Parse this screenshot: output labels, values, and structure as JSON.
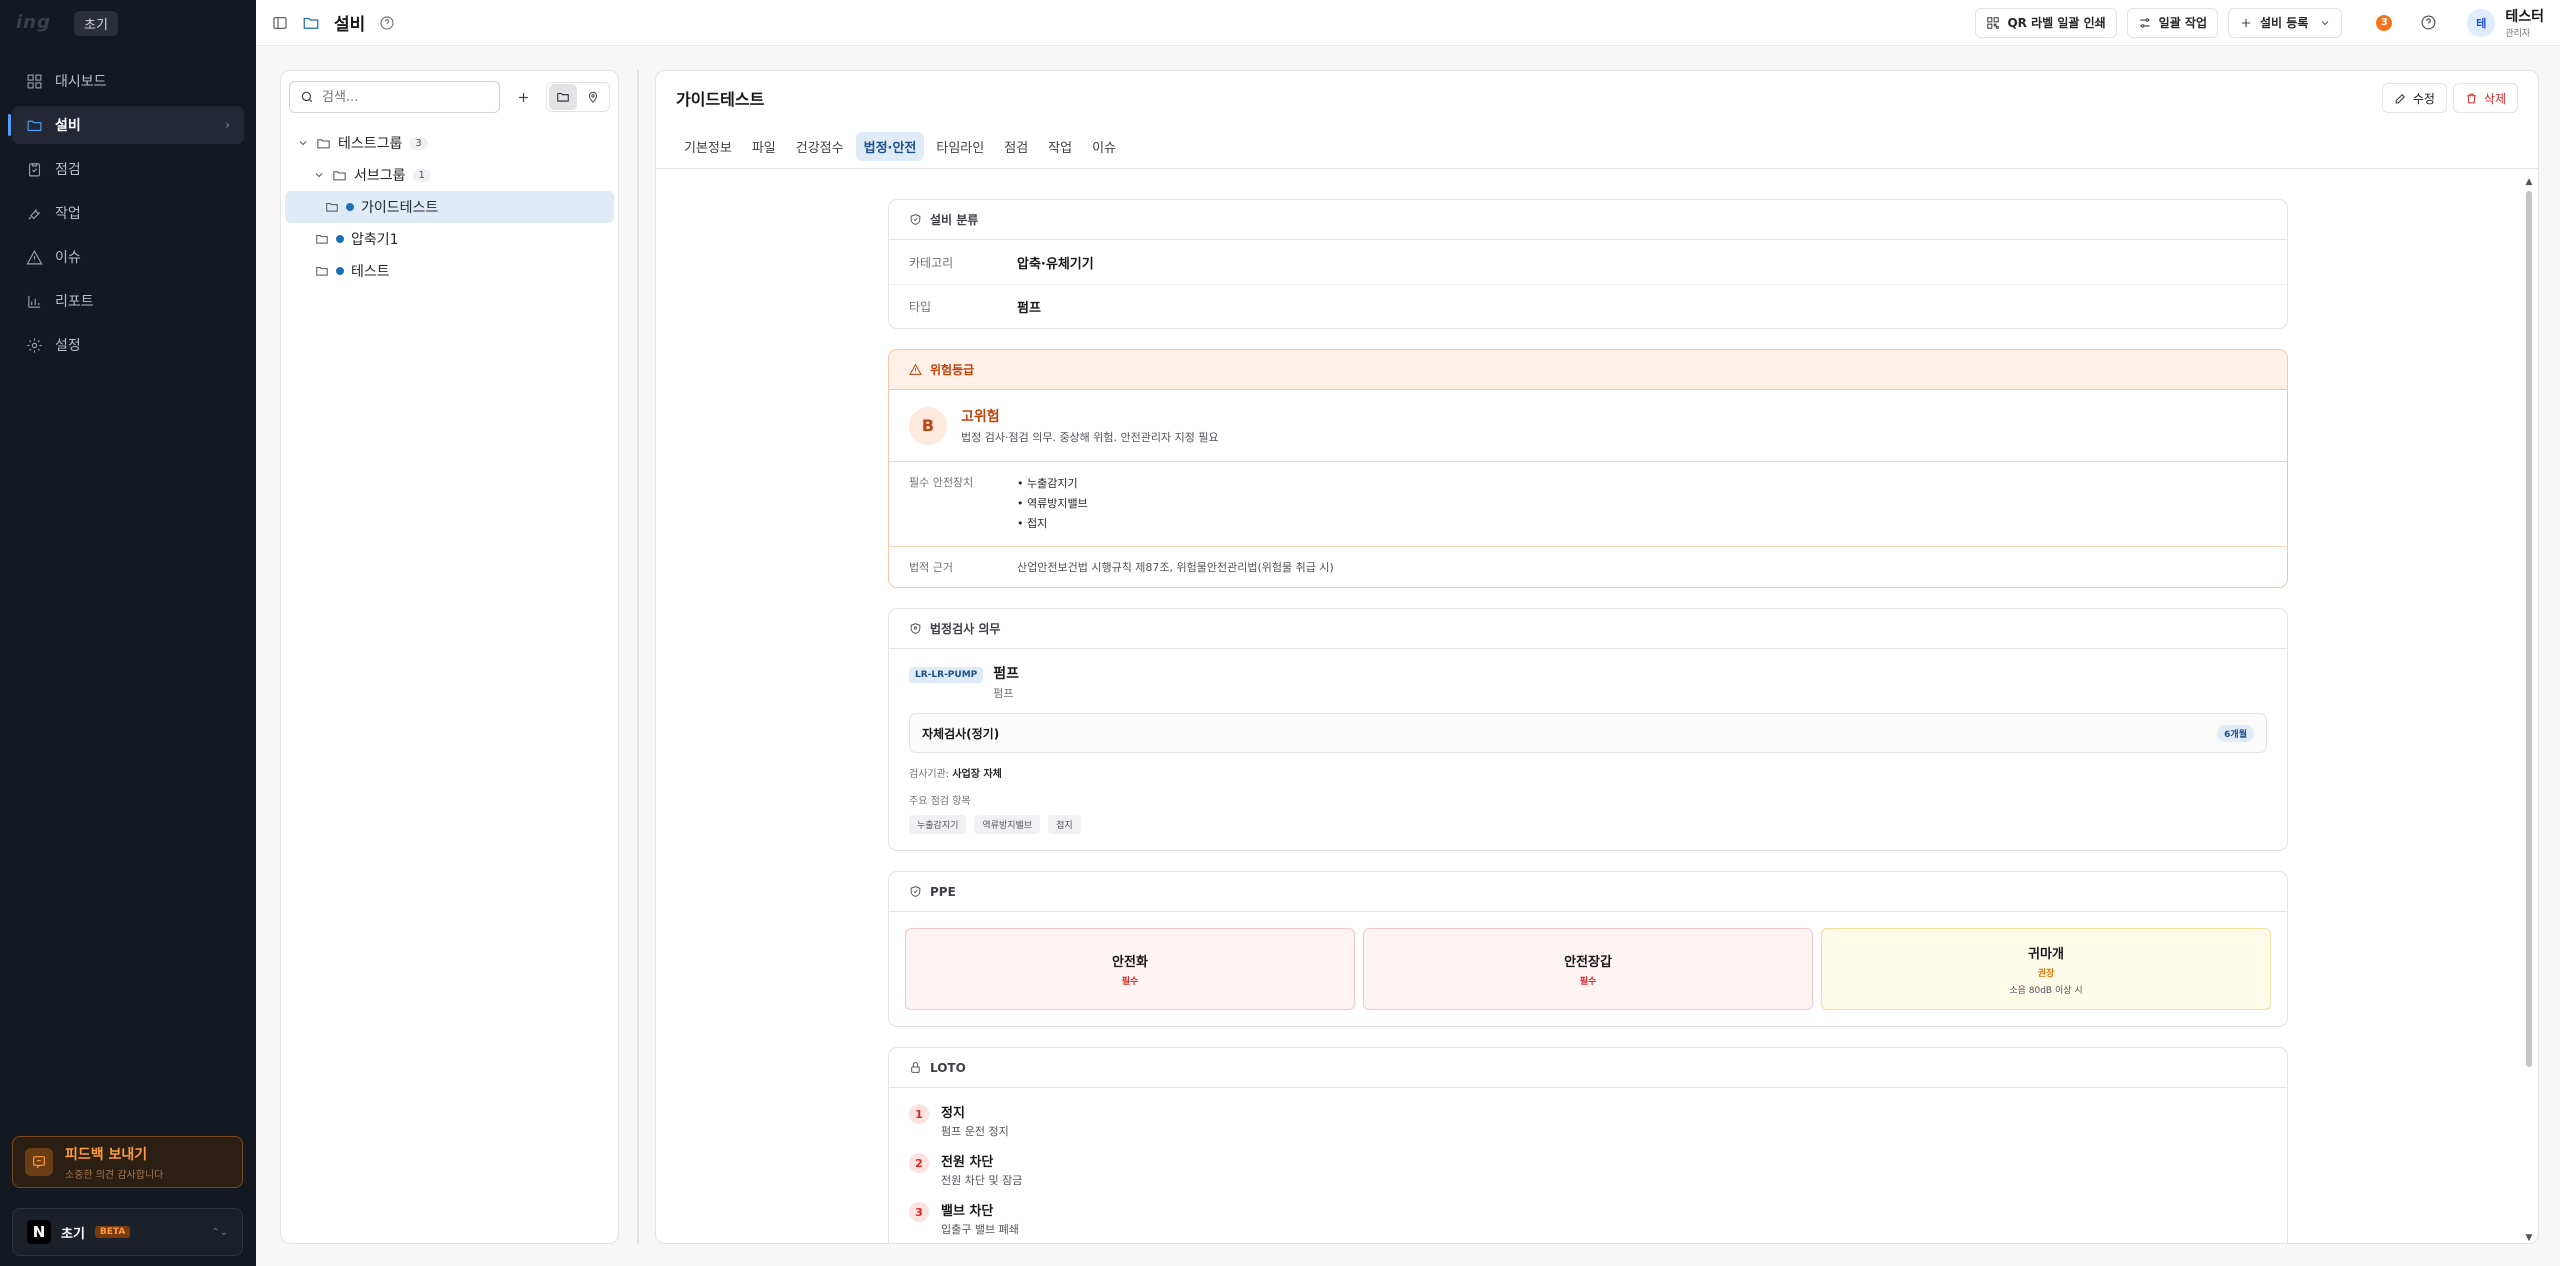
{
  "sidebar": {
    "logo": "ing",
    "org_badge": "초기",
    "items": [
      {
        "label": "대시보드",
        "icon": "grid-icon"
      },
      {
        "label": "설비",
        "icon": "folder-icon"
      },
      {
        "label": "점검",
        "icon": "clipboard-icon"
      },
      {
        "label": "작업",
        "icon": "wrench-icon"
      },
      {
        "label": "이슈",
        "icon": "alert-triangle-icon"
      },
      {
        "label": "리포트",
        "icon": "bar-chart-icon"
      },
      {
        "label": "설정",
        "icon": "gear-icon"
      }
    ],
    "feedback": {
      "title": "피드백 보내기",
      "subtitle": "소중한 의견 감사합니다"
    },
    "workspace": {
      "logo": "N",
      "name": "초기",
      "badge": "BETA"
    }
  },
  "header": {
    "title": "설비",
    "qr_label": "QR 라벨 일괄 인쇄",
    "bulk_label": "일괄 작업",
    "register_label": "설비 등록",
    "notif_count": "3",
    "user": {
      "initial": "테",
      "name": "테스터",
      "role": "관리자"
    }
  },
  "tree": {
    "search_placeholder": "검색...",
    "nodes": [
      {
        "label": "테스트그룹",
        "count": "3"
      },
      {
        "label": "서브그룹",
        "count": "1"
      },
      {
        "label": "가이드테스트"
      },
      {
        "label": "압축기1"
      },
      {
        "label": "테스트"
      }
    ]
  },
  "detail": {
    "title": "가이드테스트",
    "edit_label": "수정",
    "delete_label": "삭제",
    "tabs": [
      "기본정보",
      "파일",
      "건강점수",
      "법정·안전",
      "타임라인",
      "점검",
      "작업",
      "이슈"
    ],
    "classification": {
      "header": "설비 분류",
      "rows": [
        {
          "k": "카테고리",
          "v": "압축·유체기기"
        },
        {
          "k": "타입",
          "v": "펌프"
        }
      ]
    },
    "risk": {
      "header": "위험등급",
      "grade": "B",
      "title": "고위험",
      "desc": "법정 검사·점검 의무. 중상해 위험. 안전관리자 지정 필요",
      "devices_label": "필수 안전장치",
      "devices": [
        "누출감지기",
        "역류방지밸브",
        "접지"
      ],
      "basis_label": "법적 근거",
      "basis": "산업안전보건법 시행규칙 제87조, 위험물안전관리법(위험물 취급 시)"
    },
    "inspection": {
      "header": "법정검사 의무",
      "code": "LR-LR-PUMP",
      "name": "펌프",
      "sub": "펌프",
      "bar_title": "자체검사(정기)",
      "cycle": "6개월",
      "authority_label": "검사기관:",
      "authority": "사업장 자체",
      "items_label": "주요 점검 항목",
      "items": [
        "누출감지기",
        "역류방지밸브",
        "접지"
      ]
    },
    "ppe": {
      "header": "PPE",
      "items": [
        {
          "name": "안전화",
          "level": "필수",
          "note": ""
        },
        {
          "name": "안전장갑",
          "level": "필수",
          "note": ""
        },
        {
          "name": "귀마개",
          "level": "권장",
          "note": "소음 80dB 이상 시"
        }
      ]
    },
    "loto": {
      "header": "LOTO",
      "steps": [
        {
          "num": "1",
          "title": "정지",
          "desc": "펌프 운전 정지"
        },
        {
          "num": "2",
          "title": "전원 차단",
          "desc": "전원 차단 및 잠금"
        },
        {
          "num": "3",
          "title": "밸브 차단",
          "desc": "입출구 밸브 폐쇄"
        }
      ]
    }
  },
  "colors": {
    "accent": "#4aa3ff",
    "danger": "#dc2626",
    "warning": "#c2410c"
  }
}
